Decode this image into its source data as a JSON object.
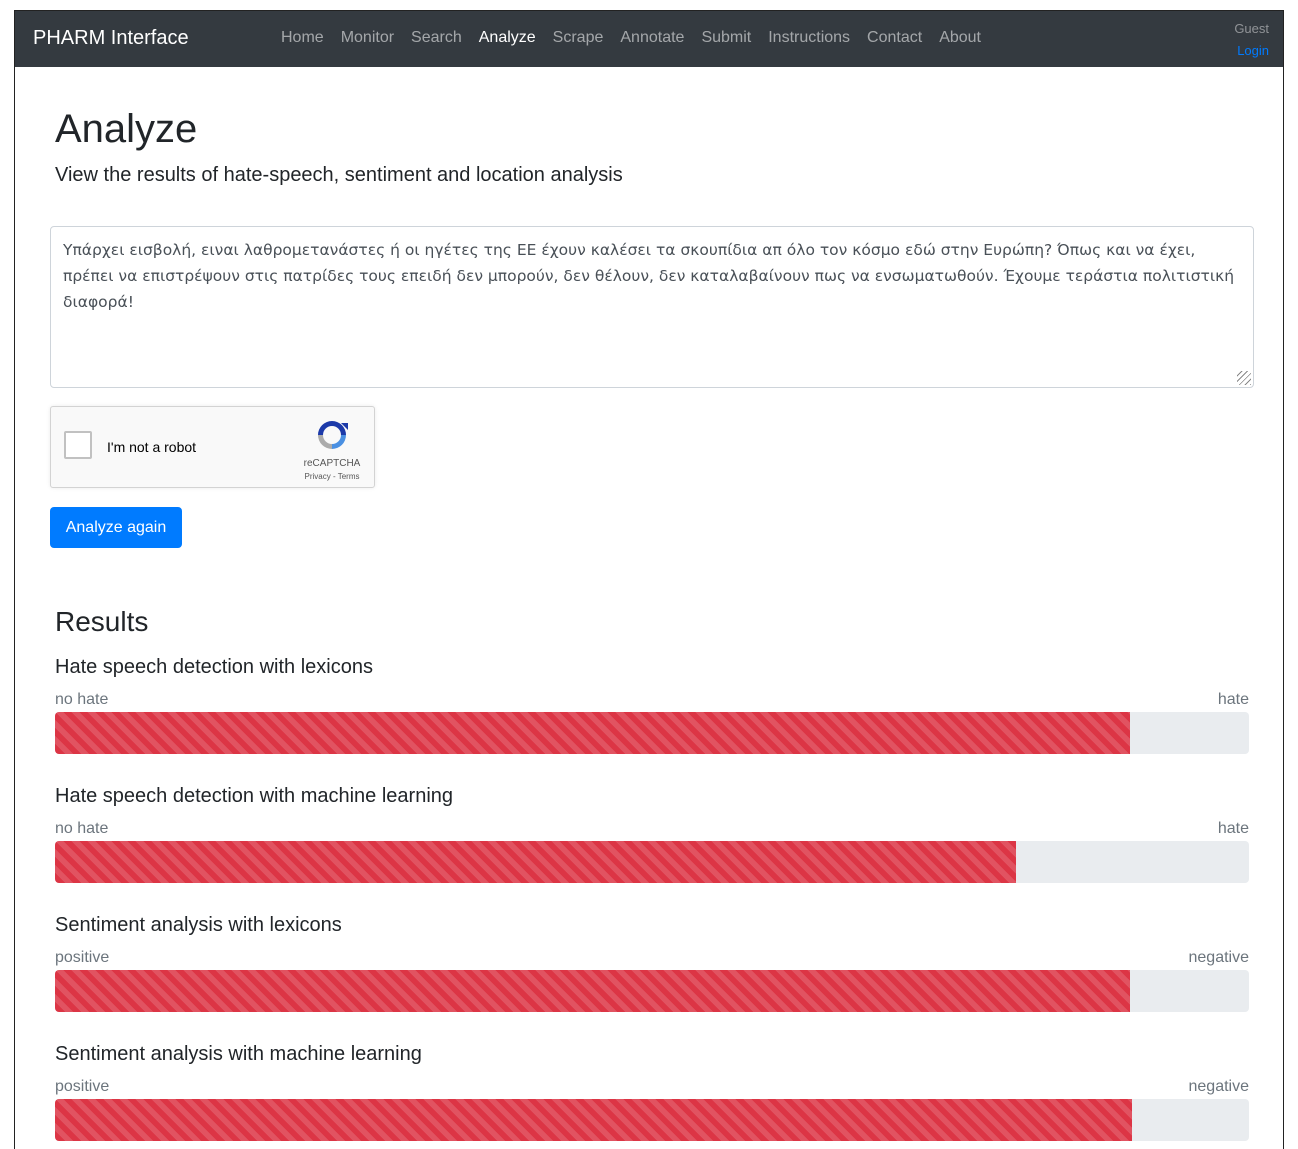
{
  "navbar": {
    "brand": "PHARM Interface",
    "items": [
      {
        "label": "Home",
        "active": false
      },
      {
        "label": "Monitor",
        "active": false
      },
      {
        "label": "Search",
        "active": false
      },
      {
        "label": "Analyze",
        "active": true
      },
      {
        "label": "Scrape",
        "active": false
      },
      {
        "label": "Annotate",
        "active": false
      },
      {
        "label": "Submit",
        "active": false
      },
      {
        "label": "Instructions",
        "active": false
      },
      {
        "label": "Contact",
        "active": false
      },
      {
        "label": "About",
        "active": false
      }
    ],
    "user": "Guest",
    "login": "Login"
  },
  "page": {
    "title": "Analyze",
    "subtitle": "View the results of hate-speech, sentiment and location analysis"
  },
  "input": {
    "value": "Υπάρχει εισβολή, ειναι λαθρομετανάστες ή οι ηγέτες της ΕΕ έχουν καλέσει τα σκουπίδια απ όλο τον κόσμο εδώ στην Ευρώπη? Όπως και να έχει, πρέπει να επιστρέψουν στις πατρίδες τους επειδή δεν μπορούν, δεν θέλουν, δεν καταλαβαίνουν πως να ενσωματωθούν. Έχουμε τεράστια πολιτιστική διαφορά!"
  },
  "captcha": {
    "label": "I'm not a robot",
    "brand": "reCAPTCHA",
    "terms": "Privacy - Terms"
  },
  "analyze_button": "Analyze again",
  "results": {
    "heading": "Results",
    "metrics": [
      {
        "title": "Hate speech detection with lexicons",
        "low": "no hate",
        "high": "hate",
        "value": 0.9
      },
      {
        "title": "Hate speech detection with machine learning",
        "low": "no hate",
        "high": "hate",
        "value": 0.805
      },
      {
        "title": "Sentiment analysis with lexicons",
        "low": "positive",
        "high": "negative",
        "value": 0.9
      },
      {
        "title": "Sentiment analysis with machine learning",
        "low": "positive",
        "high": "negative",
        "value": 0.902
      }
    ]
  },
  "colors": {
    "navbar": "#343a40",
    "primary": "#007bff",
    "danger": "#dc3545",
    "track": "#e9ecef"
  }
}
